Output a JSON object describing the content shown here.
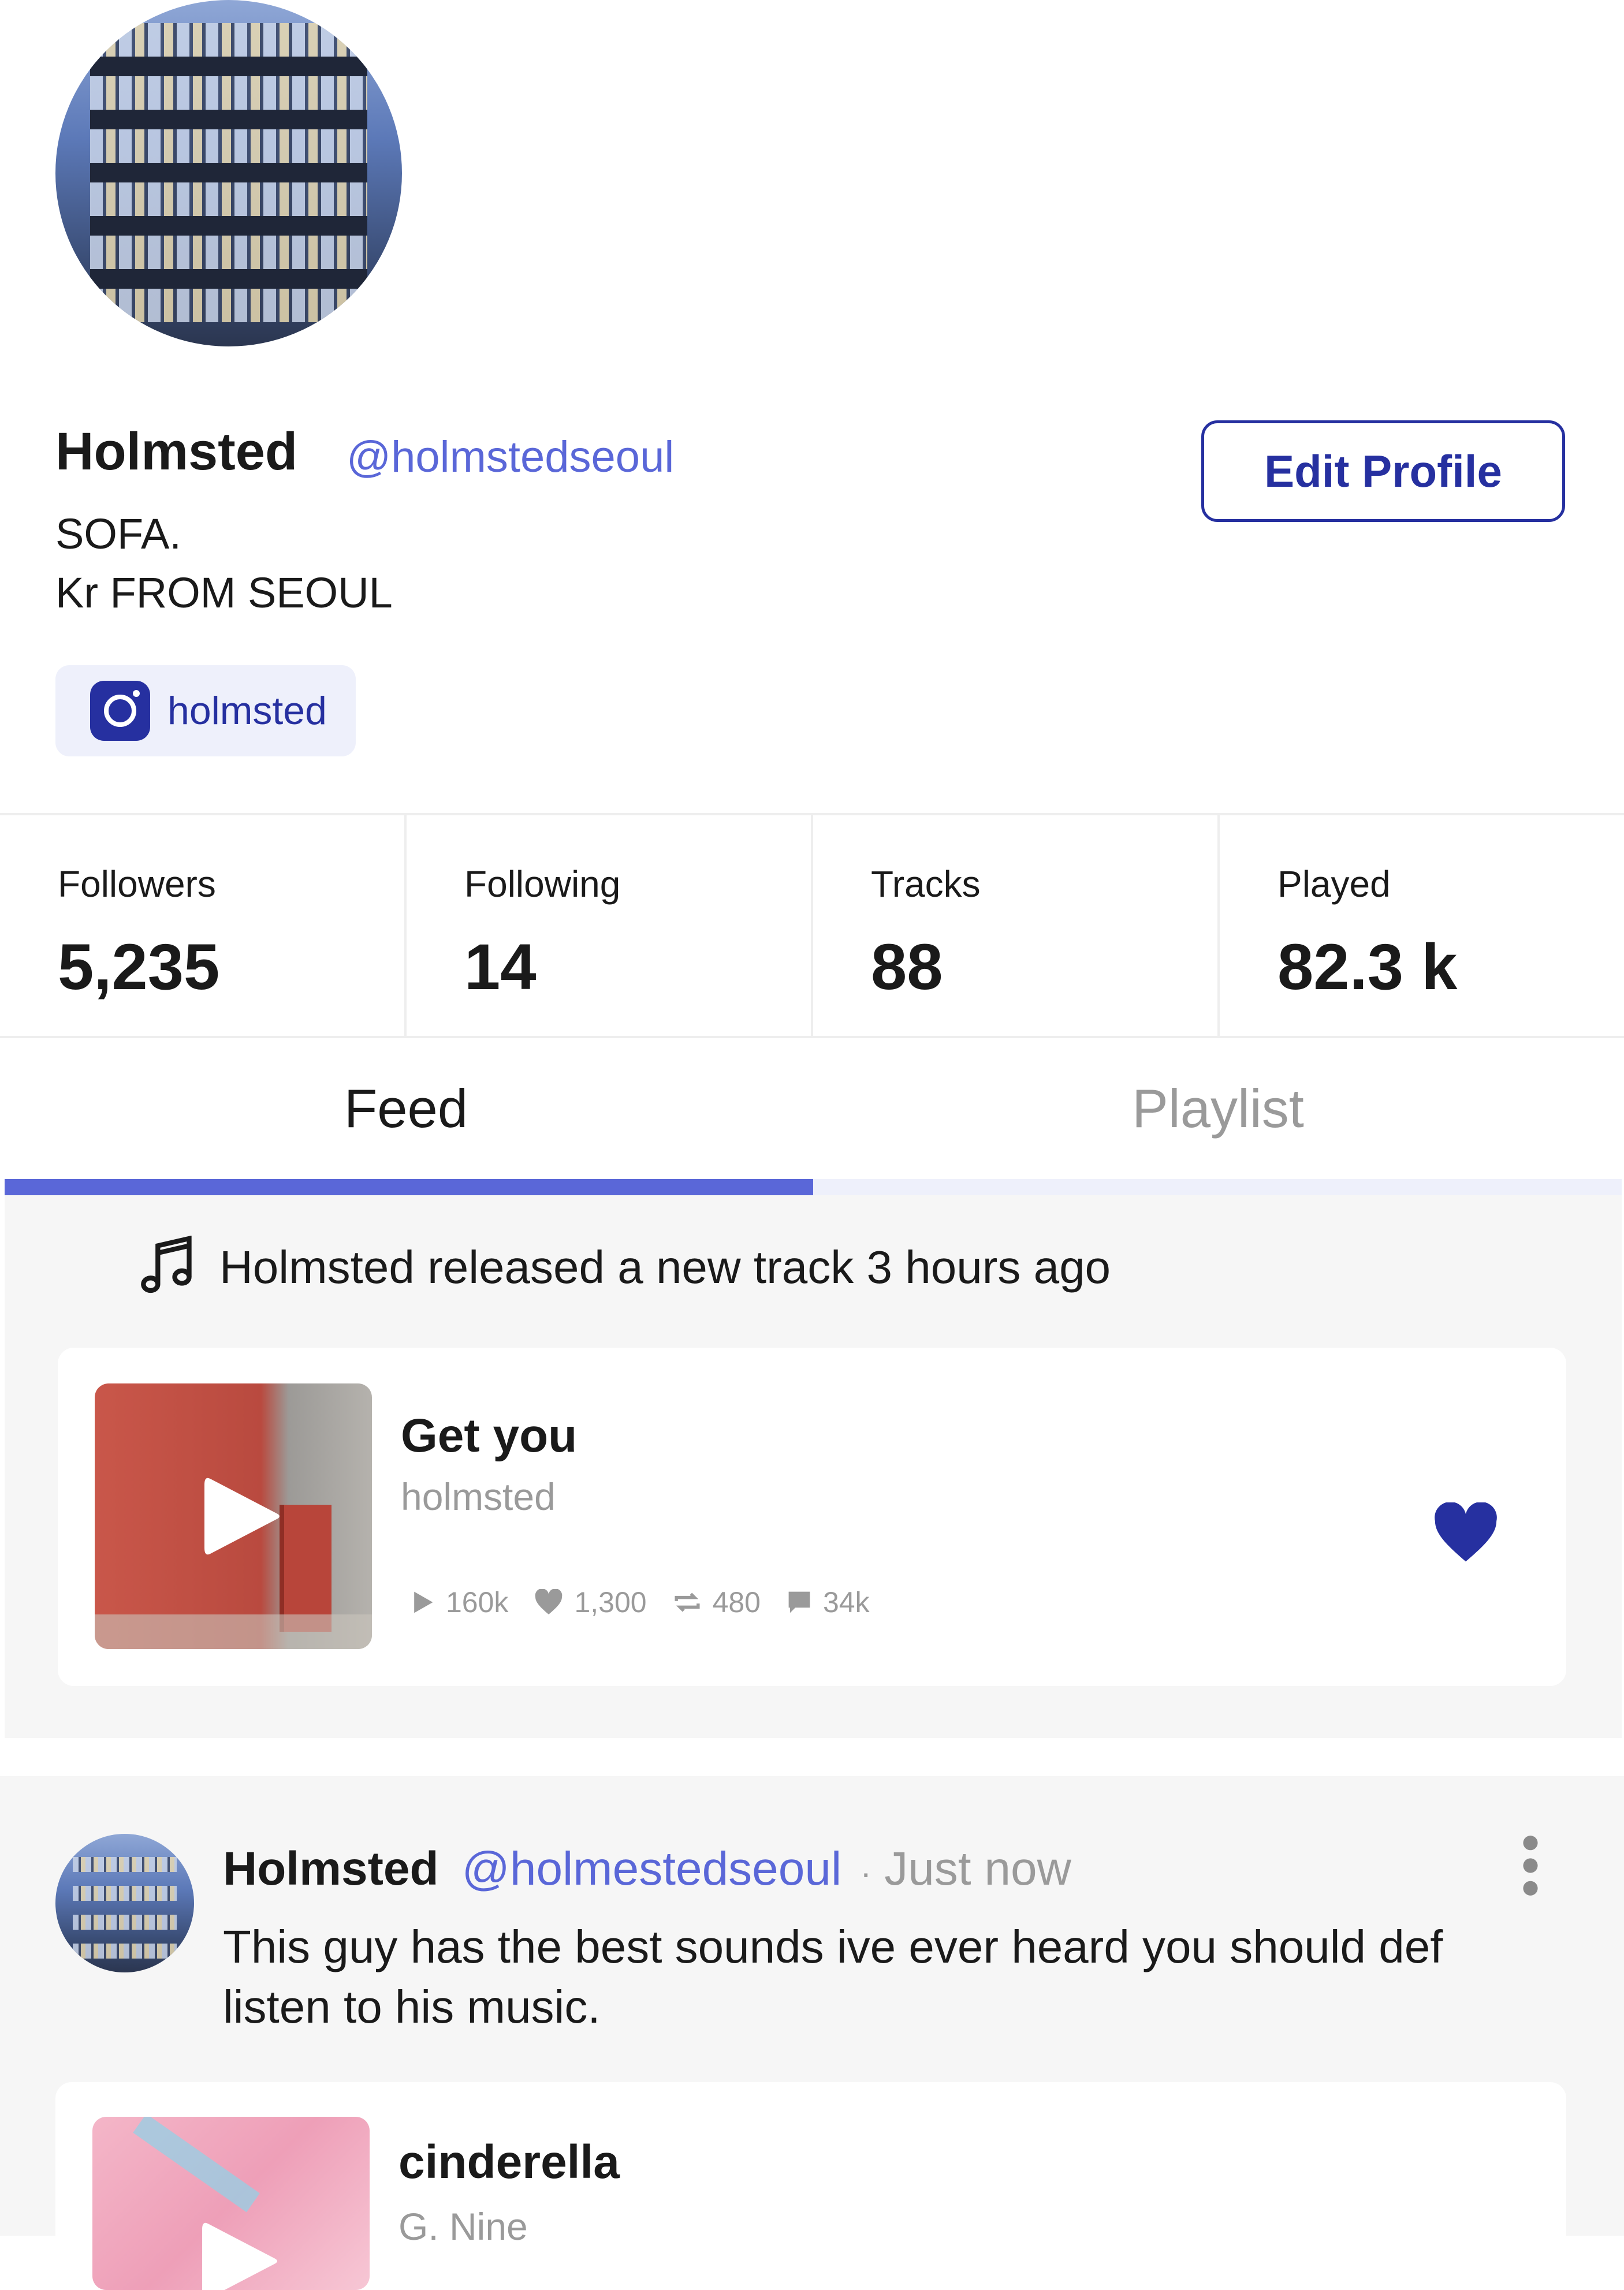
{
  "profile": {
    "name": "Holmsted",
    "handle": "@holmstedseoul",
    "bio_line1": "SOFA.",
    "bio_line2": "Kr FROM SEOUL",
    "edit_button": "Edit Profile",
    "social": {
      "icon": "instagram-icon",
      "label": "holmsted"
    }
  },
  "stats": [
    {
      "label": "Followers",
      "value": "5,235"
    },
    {
      "label": "Following",
      "value": "14"
    },
    {
      "label": "Tracks",
      "value": "88"
    },
    {
      "label": "Played",
      "value": "82.3 k"
    }
  ],
  "tabs": [
    {
      "label": "Feed",
      "active": true
    },
    {
      "label": "Playlist",
      "active": false
    }
  ],
  "feed": {
    "activity_text": "Holmsted released a new track 3 hours ago",
    "track": {
      "title": "Get you",
      "artist": "holmsted",
      "plays": "160k",
      "likes": "1,300",
      "reposts": "480",
      "comments": "34k",
      "liked": true
    }
  },
  "post": {
    "name": "Holmsted",
    "handle": "@holmestedseoul",
    "separator": "·",
    "time": "Just now",
    "text": "This guy has the best sounds ive ever heard you should def listen to his music.",
    "track": {
      "title": "cinderella",
      "artist": "G. Nine"
    }
  },
  "colors": {
    "accent": "#5a67d8",
    "brand_dark": "#2630a0",
    "muted": "#9a9a9a"
  }
}
